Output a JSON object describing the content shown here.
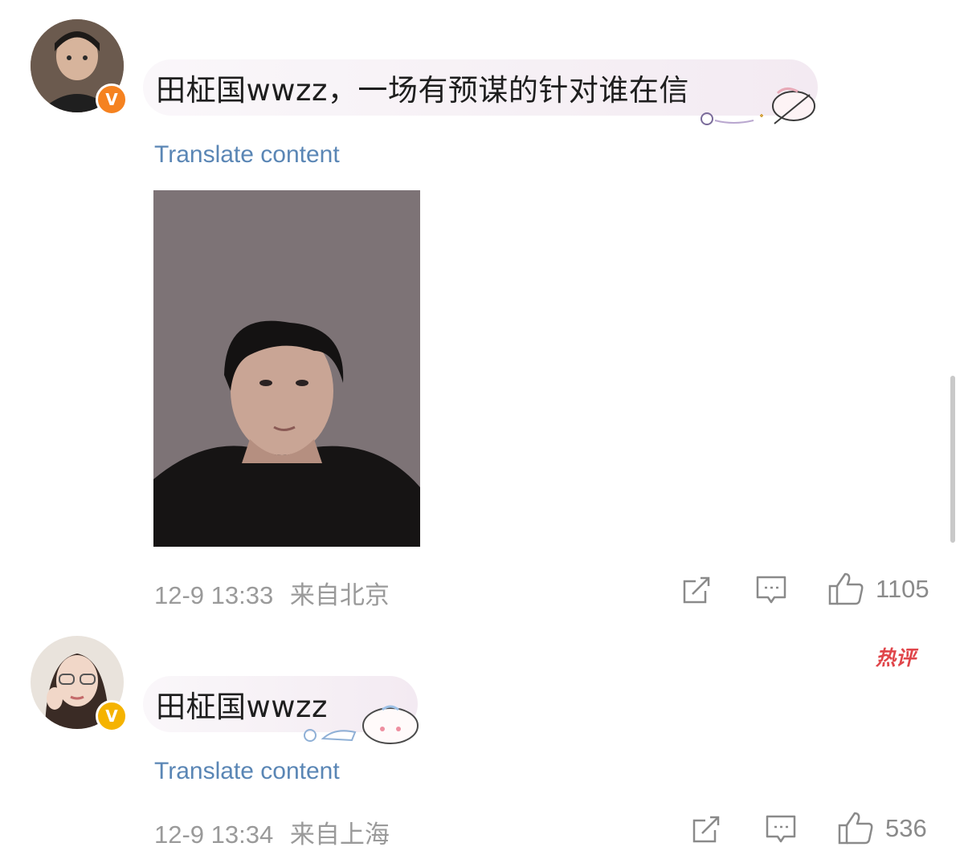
{
  "comments": [
    {
      "username": "田柾国wwzz",
      "text": "，一场有预谋的针对谁在信",
      "translate_label": "Translate content",
      "timestamp": "12-9 13:33",
      "location": "来自北京",
      "likes": "1105",
      "badge": "V",
      "badge_color": "#f58220"
    },
    {
      "username": "田柾国wwzz",
      "text": "",
      "translate_label": "Translate content",
      "timestamp": "12-9 13:34",
      "location": "来自上海",
      "likes": "536",
      "badge": "V",
      "badge_color": "#f5b300",
      "hot_tag": "热评"
    }
  ],
  "icons": [
    "share-icon",
    "comment-icon",
    "like-icon"
  ],
  "colors": {
    "translate_link": "#5a86b5",
    "meta_text": "#9a9a9a",
    "hot_tag": "#e0454a"
  }
}
